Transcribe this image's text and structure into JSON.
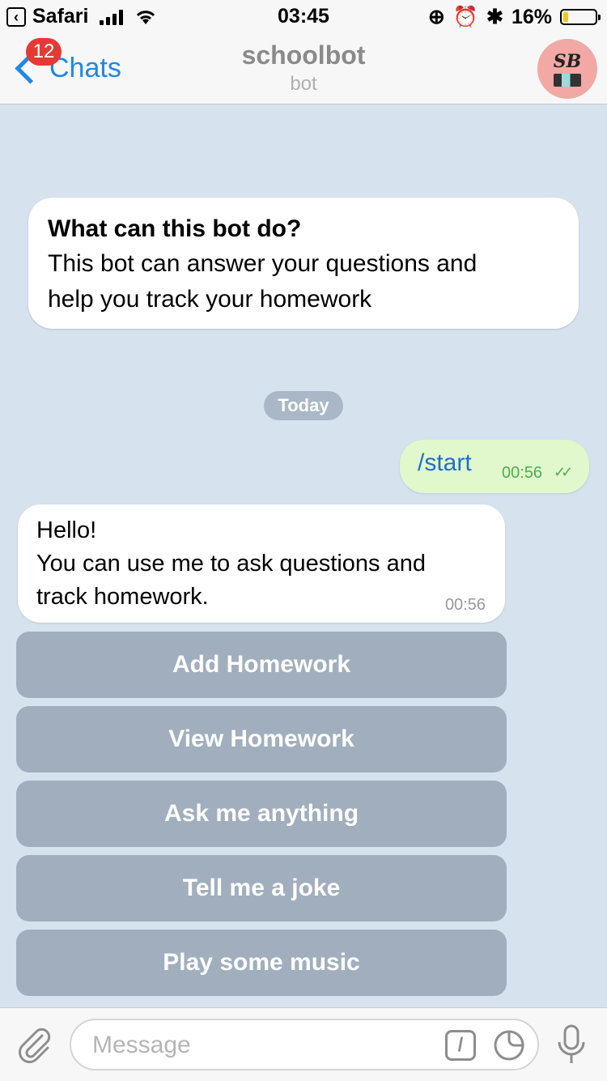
{
  "status_bar": {
    "back_app": "Safari",
    "time": "03:45",
    "battery": "16%",
    "battery_level": 0.16
  },
  "header": {
    "back_label": "Chats",
    "unread_badge": "12",
    "title": "schoolbot",
    "subtitle": "bot",
    "avatar_text": "SB"
  },
  "intro": {
    "title": "What can this bot do?",
    "line1": "This bot can answer your questions and",
    "line2": "help you track your homework"
  },
  "date_separator": "Today",
  "messages": [
    {
      "direction": "outgoing",
      "text": "/start",
      "time": "00:56",
      "status": "read"
    },
    {
      "direction": "incoming",
      "lines": [
        "Hello!",
        "You can use me to ask questions and",
        "track homework."
      ],
      "time": "00:56"
    }
  ],
  "keyboard": {
    "buttons": [
      {
        "label": "Add Homework"
      },
      {
        "label": "View Homework"
      },
      {
        "label": "Ask me anything"
      },
      {
        "label": "Tell me a joke"
      },
      {
        "label": "Play some music"
      }
    ]
  },
  "input": {
    "placeholder": "Message",
    "value": ""
  },
  "icons": {
    "attach": "paperclip-icon",
    "command": "slash-command-icon",
    "sticker": "sticker-icon",
    "voice": "microphone-icon"
  },
  "colors": {
    "accent": "#1e88e5",
    "badge": "#e53935",
    "outgoing_bubble": "#e1f8cc",
    "chat_background": "#d6e2ee"
  }
}
